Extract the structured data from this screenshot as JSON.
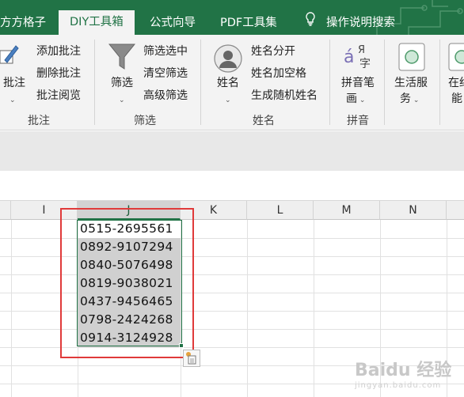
{
  "tabs": [
    {
      "label": "方方格子"
    },
    {
      "label": "DIY工具箱"
    },
    {
      "label": "公式向导"
    },
    {
      "label": "PDF工具集"
    },
    {
      "label": "操作说明搜索"
    }
  ],
  "ribbon": {
    "comment": {
      "big_label": "批注",
      "items": [
        "添加批注",
        "删除批注",
        "批注阅览"
      ],
      "group": "批注"
    },
    "filter": {
      "big_label": "筛选",
      "items": [
        "筛选选中",
        "清空筛选",
        "高级筛选"
      ],
      "group": "筛选"
    },
    "name": {
      "big_label": "姓名",
      "items": [
        "姓名分开",
        "姓名加空格",
        "生成随机姓名"
      ],
      "group": "姓名"
    },
    "pinyin": {
      "big_label_1": "拼音笔",
      "big_label_2": "画",
      "group": "拼音"
    },
    "life": {
      "big_label_1": "生活服",
      "big_label_2": "务"
    },
    "online": {
      "big_label_1": "在约",
      "big_label_2": "能"
    }
  },
  "columns": [
    "I",
    "J",
    "K",
    "L",
    "M",
    "N"
  ],
  "cells": [
    "0515-2695561",
    "0892-9107294",
    "0840-5076498",
    "0819-9038021",
    "0437-9456465",
    "0798-2424268",
    "0914-3124928"
  ],
  "watermark": {
    "brand": "Baidu 经验",
    "url": "jingyan.baidu.com"
  },
  "colors": {
    "excel_green": "#217346",
    "highlight_red": "#e03a3a",
    "selection_gray": "#d0d0d0"
  }
}
